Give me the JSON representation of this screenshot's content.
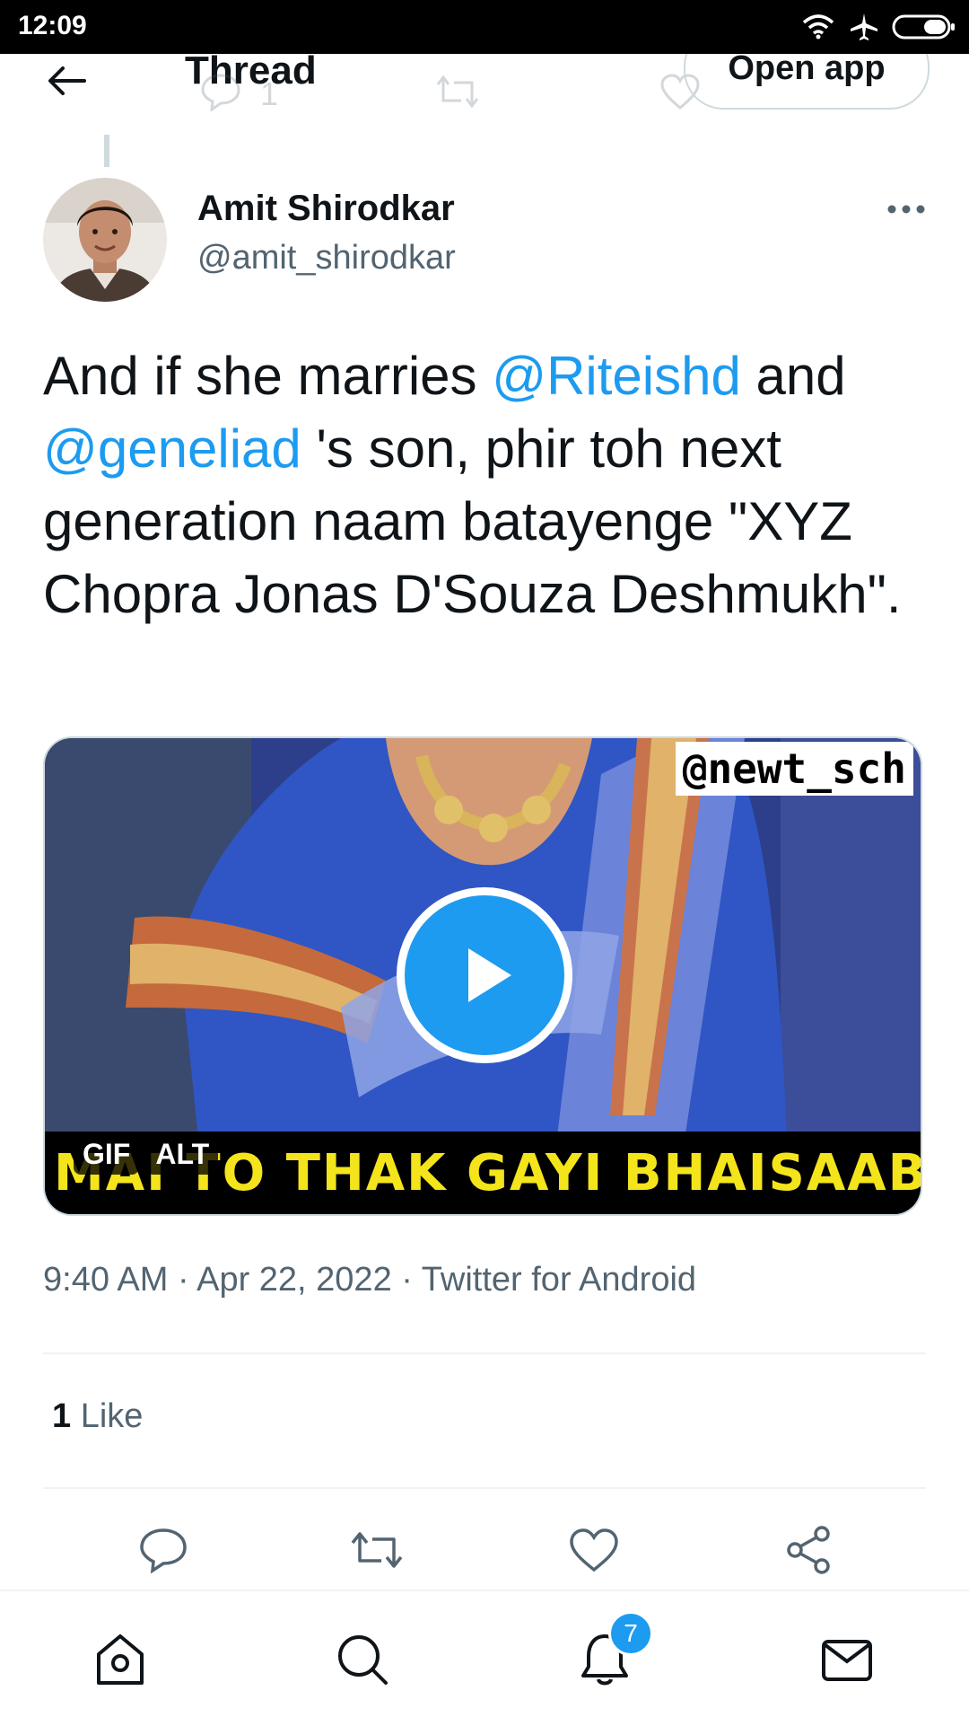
{
  "status_bar": {
    "time": "12:09"
  },
  "header": {
    "title": "Thread",
    "open_app_label": "Open app",
    "ghost_reply_count": "1"
  },
  "tweet": {
    "display_name": "Amit Shirodkar",
    "handle": "@amit_shirodkar",
    "text_parts": {
      "p1": "And if she marries ",
      "mention1": "@Riteishd",
      "p2": " and ",
      "mention2": "@geneliad",
      "p3": " 's son, phir toh next generation naam batayenge \"XYZ Chopra Jonas D'Souza Deshmukh\"."
    },
    "media": {
      "watermark": "@newt_sch",
      "caption": "MAI TO THAK GAYI BHAISAAB",
      "badge_gif": "GIF",
      "badge_alt": "ALT"
    },
    "meta": "9:40 AM · Apr 22, 2022 · Twitter for Android",
    "like_count": "1",
    "like_label": " Like"
  },
  "bottom_nav": {
    "notification_count": "7"
  },
  "colors": {
    "accent": "#1d9bf0",
    "secondary_text": "#536471",
    "caption_text": "#f4e41b"
  }
}
